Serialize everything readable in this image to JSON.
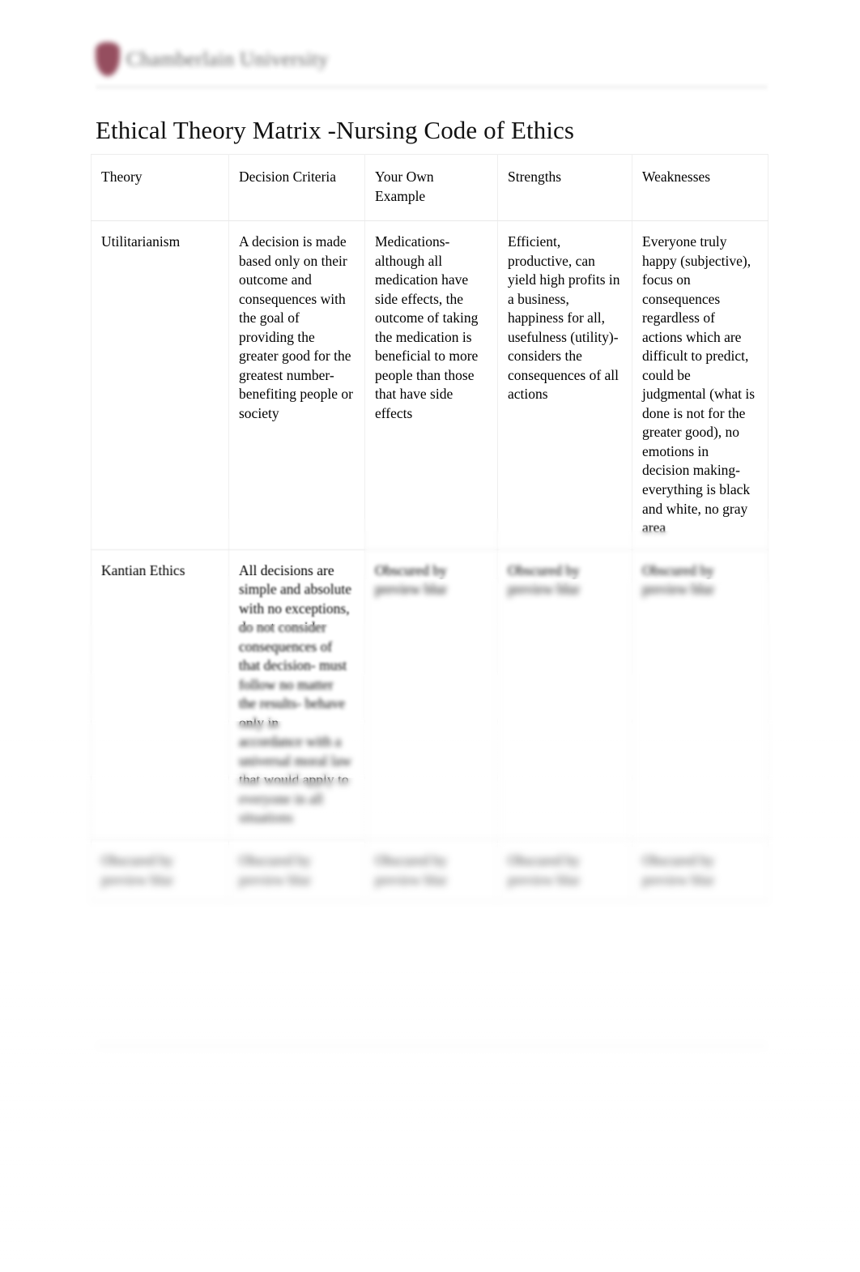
{
  "document": {
    "title": "Ethical Theory Matrix -Nursing Code of Ethics",
    "logo": {
      "mark": "shield-logo-mark",
      "wordmark": "Chamberlain University",
      "color": "#8d3f52",
      "legible": false
    }
  },
  "table": {
    "headers": [
      "Theory",
      "Decision Criteria",
      "Your Own Example",
      "Strengths",
      "Weaknesses"
    ],
    "rows": [
      {
        "theory": "Utilitarianism",
        "decision_criteria": "A decision is made based only on their outcome and consequences with the goal of providing the greater good for the greatest number- benefiting people or society",
        "your_own_example": "Medications- although all medication have side effects, the outcome of taking the medication is beneficial to more people than those that have side effects",
        "strengths": "Efficient, productive, can yield high profits in a business, happiness for all, usefulness (utility)- considers the consequences of all actions",
        "weaknesses": "Everyone truly happy (subjective), focus on consequences regardless of actions which are difficult to predict, could be judgmental (what is done is not for the greater good), no emotions in decision making- everything is black and white, no gray area"
      },
      {
        "theory": "Kantian Ethics",
        "decision_criteria": "All decisions are simple and absolute with no exceptions, do not consider consequences of that decision- must follow no matter the results- behave only in",
        "decision_criteria_obscured": "accordance with a universal moral law that would apply to everyone in all situations",
        "your_own_example": "",
        "your_own_example_obscured": "Obscured by preview blur",
        "strengths": "",
        "strengths_obscured": "Obscured by preview blur",
        "weaknesses": "",
        "weaknesses_obscured": "Obscured by preview blur"
      },
      {
        "theory": "",
        "theory_obscured": "Obscured by preview blur",
        "decision_criteria": "",
        "decision_criteria_obscured": "Obscured by preview blur",
        "your_own_example": "",
        "your_own_example_obscured": "Obscured by preview blur",
        "strengths": "",
        "strengths_obscured": "Obscured by preview blur",
        "weaknesses": "",
        "weaknesses_obscured": "Obscured by preview blur"
      }
    ]
  }
}
